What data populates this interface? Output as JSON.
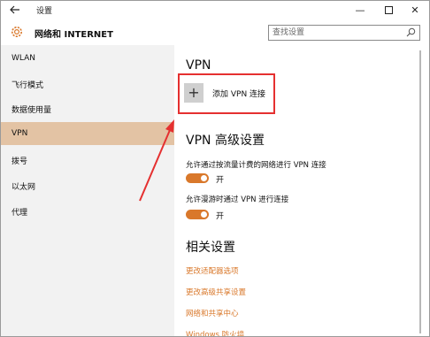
{
  "window": {
    "title": "设置",
    "back_icon": "back-arrow-icon",
    "controls": {
      "minimize": "—",
      "close": "✕"
    }
  },
  "header": {
    "title": "网络和 INTERNET",
    "icon": "gear-icon",
    "search": {
      "placeholder": "查找设置",
      "value": ""
    }
  },
  "sidebar": {
    "items": [
      {
        "label": "WLAN",
        "active": false
      },
      {
        "label": "飞行模式",
        "active": false
      },
      {
        "label": "数据使用量",
        "active": false
      },
      {
        "label": "VPN",
        "active": true
      },
      {
        "label": "拨号",
        "active": false
      },
      {
        "label": "以太网",
        "active": false
      },
      {
        "label": "代理",
        "active": false
      }
    ]
  },
  "content": {
    "vpn_heading": "VPN",
    "add_vpn": {
      "icon_glyph": "+",
      "label": "添加 VPN 连接"
    },
    "advanced_heading": "VPN 高级设置",
    "options": [
      {
        "label": "允许通过按流量计费的网络进行 VPN 连接",
        "state": "开",
        "on": true
      },
      {
        "label": "允许漫游时通过 VPN 进行连接",
        "state": "开",
        "on": true
      }
    ],
    "related_heading": "相关设置",
    "links": [
      "更改适配器选项",
      "更改高级共享设置",
      "网络和共享中心",
      "Windows 防火墙"
    ]
  },
  "colors": {
    "accent": "#d9782b",
    "active_nav": "#e3c3a4",
    "annotation": "#e53030",
    "sidebar_bg": "#f2f2f2"
  }
}
